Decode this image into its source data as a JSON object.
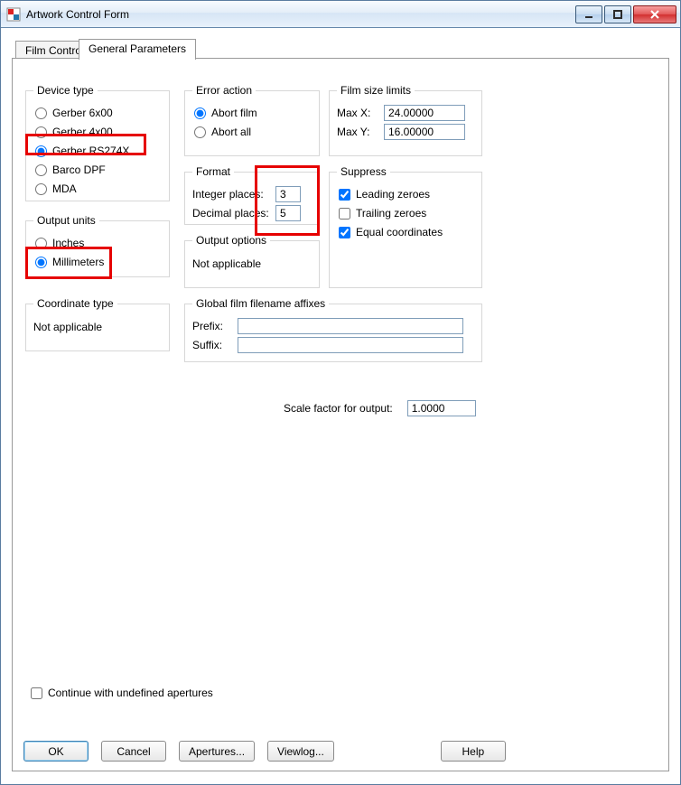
{
  "window": {
    "title": "Artwork Control Form"
  },
  "tabs": {
    "film_control": "Film Control",
    "general_parameters": "General Parameters"
  },
  "device_type": {
    "legend": "Device type",
    "options": {
      "gerber6x00": "Gerber 6x00",
      "gerber4x00": "Gerber 4x00",
      "gerber_rs274x": "Gerber RS274X",
      "barco_dpf": "Barco DPF",
      "mda": "MDA"
    },
    "selected": "gerber_rs274x"
  },
  "output_units": {
    "legend": "Output units",
    "options": {
      "inches": "Inches",
      "millimeters": "Millimeters"
    },
    "selected": "millimeters"
  },
  "coordinate_type": {
    "legend": "Coordinate type",
    "value": "Not applicable"
  },
  "error_action": {
    "legend": "Error action",
    "options": {
      "abort_film": "Abort film",
      "abort_all": "Abort all"
    },
    "selected": "abort_film"
  },
  "format": {
    "legend": "Format",
    "integer_label": "Integer places:",
    "integer_value": "3",
    "decimal_label": "Decimal places:",
    "decimal_value": "5"
  },
  "output_options": {
    "legend": "Output options",
    "value": "Not applicable"
  },
  "film_size": {
    "legend": "Film size limits",
    "maxx_label": "Max X:",
    "maxx_value": "24.00000",
    "maxy_label": "Max Y:",
    "maxy_value": "16.00000"
  },
  "suppress": {
    "legend": "Suppress",
    "leading": {
      "label": "Leading zeroes",
      "checked": true
    },
    "trailing": {
      "label": "Trailing zeroes",
      "checked": false
    },
    "equal": {
      "label": "Equal coordinates",
      "checked": true
    }
  },
  "global_affixes": {
    "legend": "Global film filename affixes",
    "prefix_label": "Prefix:",
    "prefix_value": "",
    "suffix_label": "Suffix:",
    "suffix_value": ""
  },
  "scale_factor": {
    "label": "Scale factor for output:",
    "value": "1.0000"
  },
  "continue_apertures": {
    "label": "Continue with undefined apertures",
    "checked": false
  },
  "buttons": {
    "ok": "OK",
    "cancel": "Cancel",
    "apertures": "Apertures...",
    "viewlog": "Viewlog...",
    "help": "Help"
  }
}
